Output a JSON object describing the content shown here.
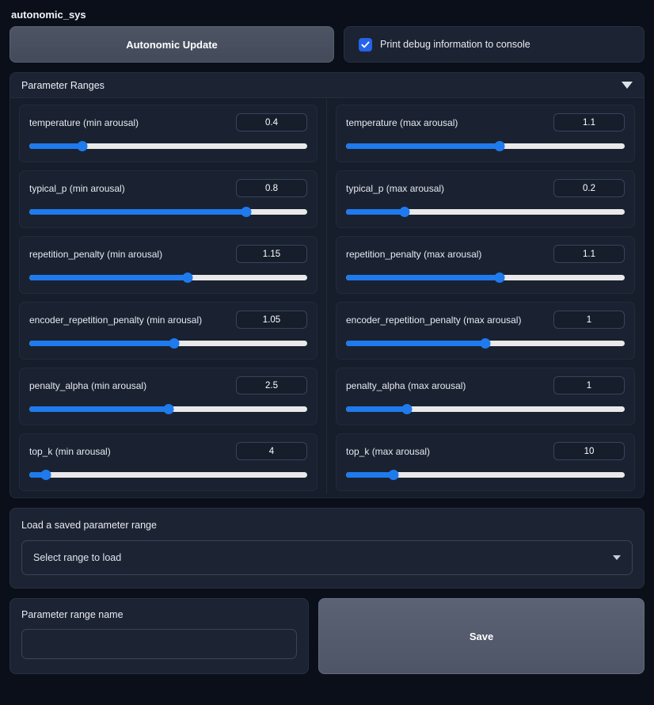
{
  "app": {
    "title": "autonomic_sys"
  },
  "toolbar": {
    "update_button_label": "Autonomic Update",
    "debug_checkbox_label": "Print debug information to console",
    "debug_checked": true
  },
  "accordion": {
    "title": "Parameter Ranges",
    "expanded": true
  },
  "parameters": [
    {
      "min": {
        "label": "temperature (min arousal)",
        "value": "0.4",
        "pct": 19
      },
      "max": {
        "label": "temperature (max arousal)",
        "value": "1.1",
        "pct": 55
      }
    },
    {
      "min": {
        "label": "typical_p (min arousal)",
        "value": "0.8",
        "pct": 78
      },
      "max": {
        "label": "typical_p (max arousal)",
        "value": "0.2",
        "pct": 21
      }
    },
    {
      "min": {
        "label": "repetition_penalty (min arousal)",
        "value": "1.15",
        "pct": 57
      },
      "max": {
        "label": "repetition_penalty (max arousal)",
        "value": "1.1",
        "pct": 55
      }
    },
    {
      "min": {
        "label": "encoder_repetition_penalty (min arousal)",
        "value": "1.05",
        "pct": 52
      },
      "max": {
        "label": "encoder_repetition_penalty (max arousal)",
        "value": "1",
        "pct": 50
      }
    },
    {
      "min": {
        "label": "penalty_alpha (min arousal)",
        "value": "2.5",
        "pct": 50
      },
      "max": {
        "label": "penalty_alpha (max arousal)",
        "value": "1",
        "pct": 22
      }
    },
    {
      "min": {
        "label": "top_k (min arousal)",
        "value": "4",
        "pct": 6
      },
      "max": {
        "label": "top_k (max arousal)",
        "value": "10",
        "pct": 17
      }
    }
  ],
  "load_section": {
    "label": "Load a saved parameter range",
    "select_value": "Select range to load"
  },
  "save_section": {
    "name_label": "Parameter range name",
    "name_value": "",
    "name_placeholder": "",
    "save_label": "Save"
  },
  "colors": {
    "accent": "#1f7aed",
    "checkbox": "#2563eb",
    "page_bg": "#0b0f19",
    "panel_bg": "#1c2434",
    "card_bg": "#1a2231",
    "track": "#e9e9ea"
  }
}
